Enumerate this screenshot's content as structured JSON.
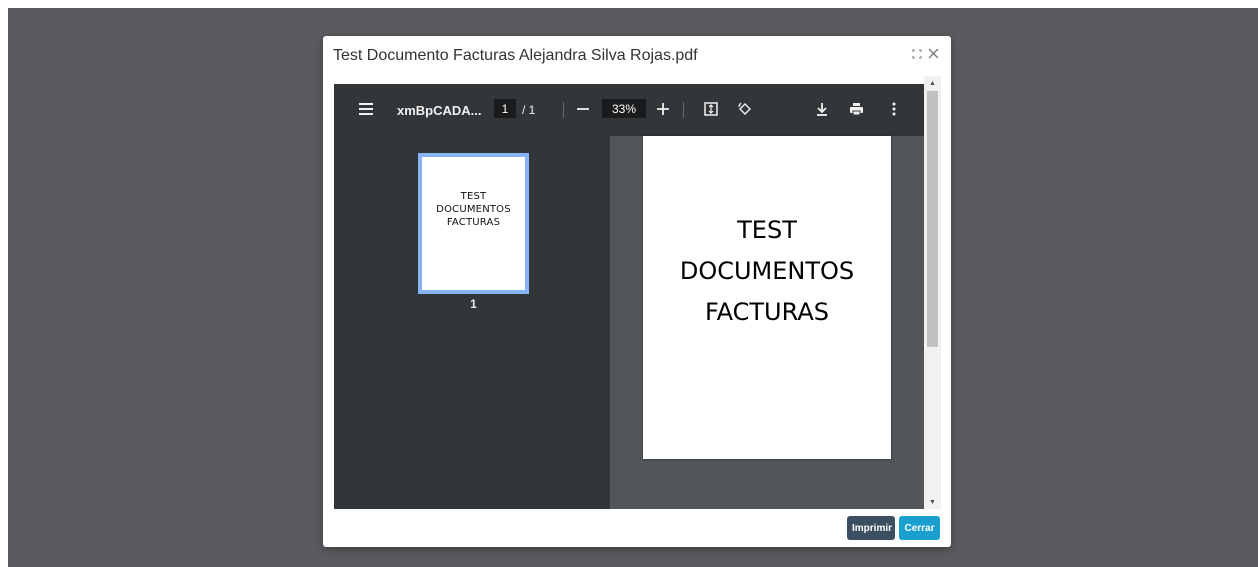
{
  "modal": {
    "title": "Test Documento Facturas Alejandra Silva Rojas.pdf",
    "print_button": "Imprimir",
    "close_button": "Cerrar"
  },
  "viewer": {
    "file_name": "xmBpCADA...",
    "current_page": "1",
    "page_separator": "/ 1",
    "zoom": "33%",
    "thumbnail": {
      "lines": [
        "TEST",
        "DOCUMENTOS",
        "FACTURAS"
      ],
      "page_number": "1"
    },
    "page_content": [
      "TEST",
      "DOCUMENTOS",
      "FACTURAS"
    ]
  },
  "icons": [
    "menu-icon",
    "minus-icon",
    "plus-icon",
    "fit-page-icon",
    "rotate-icon",
    "download-icon",
    "print-icon",
    "more-icon",
    "expand-icon",
    "close-icon"
  ],
  "colors": {
    "backdrop": "#5b5b5f",
    "toolbar": "#323639",
    "viewer_bg": "#525659",
    "thumb_border": "#8ab4f8",
    "print_button": "#3b4f63",
    "close_button": "#1aa0cf"
  }
}
